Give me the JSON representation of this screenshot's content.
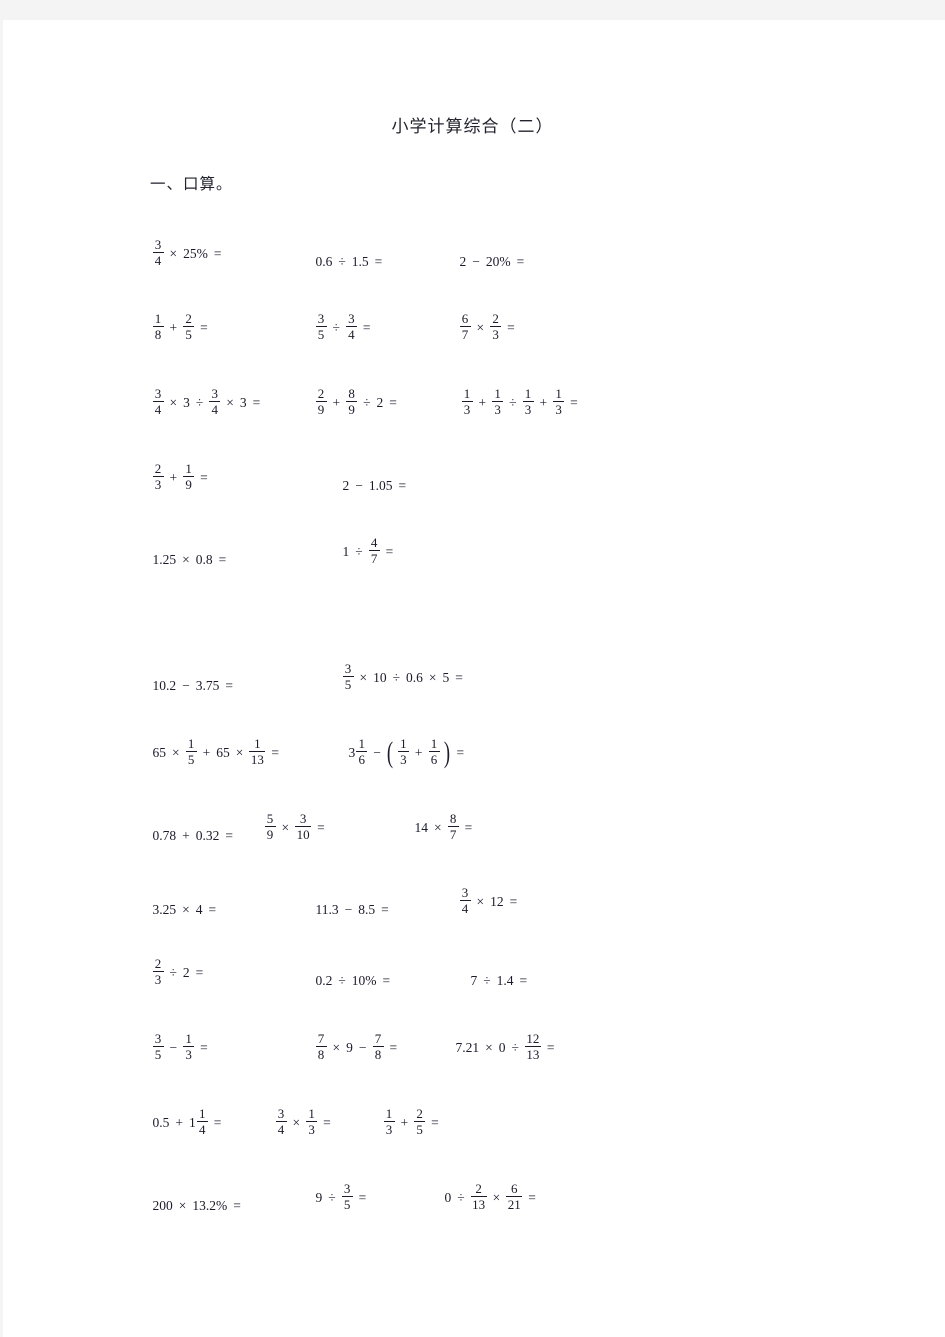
{
  "document": {
    "title": "小学计算综合（二）",
    "section_heading": "一、口算。"
  },
  "exercises": {
    "section_label": "一、口算。",
    "rows": [
      {
        "row": 1,
        "items": [
          {
            "id": "q1",
            "text": "3/4 × 25% ="
          },
          {
            "id": "q2",
            "text": "0.6 ÷ 1.5 ="
          },
          {
            "id": "q3",
            "text": "2 − 20% ="
          }
        ]
      },
      {
        "row": 2,
        "items": [
          {
            "id": "q4",
            "text": "1/8 + 2/5 ="
          },
          {
            "id": "q5",
            "text": "3/5 ÷ 3/4 ="
          },
          {
            "id": "q6",
            "text": "6/7 × 2/3 ="
          }
        ]
      },
      {
        "row": 3,
        "items": [
          {
            "id": "q7",
            "text": "3/4 × 3 ÷ 3/4 × 3 ="
          },
          {
            "id": "q8",
            "text": "2/9 + 8/9 ÷ 2 ="
          },
          {
            "id": "q9",
            "text": "1/3 + 1/3 ÷ 1/3 + 1/3 ="
          }
        ]
      },
      {
        "row": 4,
        "items": [
          {
            "id": "q10",
            "text": "2/3 + 1/9 ="
          },
          {
            "id": "q11",
            "text": "2 − 1.05 ="
          }
        ]
      },
      {
        "row": 5,
        "items": [
          {
            "id": "q12",
            "text": "1.25 × 0.8 ="
          },
          {
            "id": "q13",
            "text": "1 ÷ 4/7 ="
          }
        ]
      },
      {
        "row": 6,
        "items": [
          {
            "id": "q14",
            "text": "10.2 − 3.75 ="
          },
          {
            "id": "q15",
            "text": "3/5 × 10 ÷ 0.6 × 5 ="
          }
        ]
      },
      {
        "row": 7,
        "items": [
          {
            "id": "q16",
            "text": "65 × 1/5 + 65 × 1/13 ="
          },
          {
            "id": "q17",
            "text": "3 1/6 − (1/3 + 1/6) ="
          }
        ]
      },
      {
        "row": 8,
        "items": [
          {
            "id": "q18",
            "text": "0.78 + 0.32 ="
          },
          {
            "id": "q19",
            "text": "5/9 × 3/10 ="
          },
          {
            "id": "q20",
            "text": "14 × 8/7 ="
          }
        ]
      },
      {
        "row": 9,
        "items": [
          {
            "id": "q21",
            "text": "3.25 × 4 ="
          },
          {
            "id": "q22",
            "text": "11.3 − 8.5 ="
          },
          {
            "id": "q23",
            "text": "3/4 × 12 ="
          }
        ]
      },
      {
        "row": 10,
        "items": [
          {
            "id": "q24",
            "text": "2/3 ÷ 2 ="
          },
          {
            "id": "q25",
            "text": "0.2 ÷ 10% ="
          },
          {
            "id": "q26",
            "text": "7 ÷ 1.4 ="
          }
        ]
      },
      {
        "row": 11,
        "items": [
          {
            "id": "q27",
            "text": "3/5 − 1/3 ="
          },
          {
            "id": "q28",
            "text": "7/8 × 9 − 7/8 ="
          },
          {
            "id": "q29",
            "text": "7.21 × 0 ÷ 12/13 ="
          }
        ]
      },
      {
        "row": 12,
        "items": [
          {
            "id": "q30",
            "text": "0.5 + 1 1/4 ="
          },
          {
            "id": "q31",
            "text": "3/4 × 1/3 ="
          },
          {
            "id": "q32",
            "text": "1/3 + 2/5 ="
          }
        ]
      },
      {
        "row": 13,
        "items": [
          {
            "id": "q33",
            "text": "200 × 13.2% ="
          },
          {
            "id": "q34",
            "text": "9 ÷ 3/5 ="
          },
          {
            "id": "q35",
            "text": "0 ÷ 2/13 × 6/21 ="
          }
        ]
      }
    ],
    "tokens": {
      "times": "×",
      "divide": "÷",
      "plus": "+",
      "minus": "−",
      "equals": "=",
      "percent": "%",
      "lparen": "(",
      "rparen": ")"
    },
    "numbers": {
      "n0": "0",
      "n1": "1",
      "n2": "2",
      "n3": "3",
      "n4": "4",
      "n5": "5",
      "n6": "6",
      "n7": "7",
      "n8": "8",
      "n9": "9",
      "n10": "10",
      "n12": "12",
      "n13": "13",
      "n14": "14",
      "n21": "21",
      "n65": "65",
      "n200": "200",
      "d006": "0.6",
      "d015": "1.5",
      "d105": "1.05",
      "d125": "1.25",
      "d08": "0.8",
      "d102": "10.2",
      "d375": "3.75",
      "d078": "0.78",
      "d032": "0.32",
      "d325": "3.25",
      "d113": "11.3",
      "d85": "8.5",
      "d02": "0.2",
      "d14": "1.4",
      "d721": "7.21",
      "d05": "0.5",
      "p25": "25%",
      "p20": "20%",
      "p10": "10%",
      "p132": "13.2%"
    }
  },
  "colors": {
    "text": "#1b1b2b",
    "page_background": "#ffffff",
    "canvas_background": "#f4f4f4"
  }
}
